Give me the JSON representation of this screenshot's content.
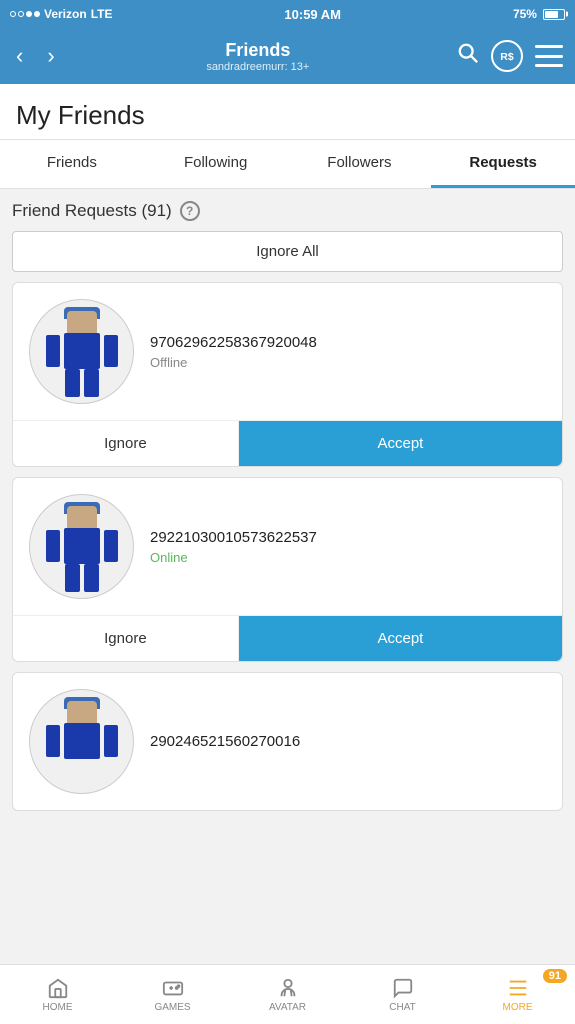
{
  "statusBar": {
    "carrier": "Verizon",
    "network": "LTE",
    "time": "10:59 AM",
    "battery": "75%"
  },
  "header": {
    "title": "Friends",
    "subtitle": "sandradreemurr: 13+",
    "back_label": "‹",
    "forward_label": "›"
  },
  "pageTitle": "My Friends",
  "tabs": [
    {
      "label": "Friends",
      "active": false
    },
    {
      "label": "Following",
      "active": false
    },
    {
      "label": "Followers",
      "active": false
    },
    {
      "label": "Requests",
      "active": true
    }
  ],
  "friendRequests": {
    "heading": "Friend Requests (91)",
    "ignoreAllLabel": "Ignore All",
    "requests": [
      {
        "id": 1,
        "username": "97062962258367920048",
        "status": "Offline",
        "statusType": "offline",
        "ignoreLabel": "Ignore",
        "acceptLabel": "Accept"
      },
      {
        "id": 2,
        "username": "29221030010573622537",
        "status": "Online",
        "statusType": "online",
        "ignoreLabel": "Ignore",
        "acceptLabel": "Accept"
      },
      {
        "id": 3,
        "username": "290246521560270016",
        "status": "",
        "statusType": "unknown"
      }
    ]
  },
  "bottomNav": [
    {
      "id": "home",
      "label": "HOME",
      "active": false
    },
    {
      "id": "games",
      "label": "GAMES",
      "active": false
    },
    {
      "id": "avatar",
      "label": "AVATAR",
      "active": false
    },
    {
      "id": "chat",
      "label": "CHAT",
      "active": false
    },
    {
      "id": "more",
      "label": "MORE",
      "active": true,
      "badge": "91"
    }
  ]
}
